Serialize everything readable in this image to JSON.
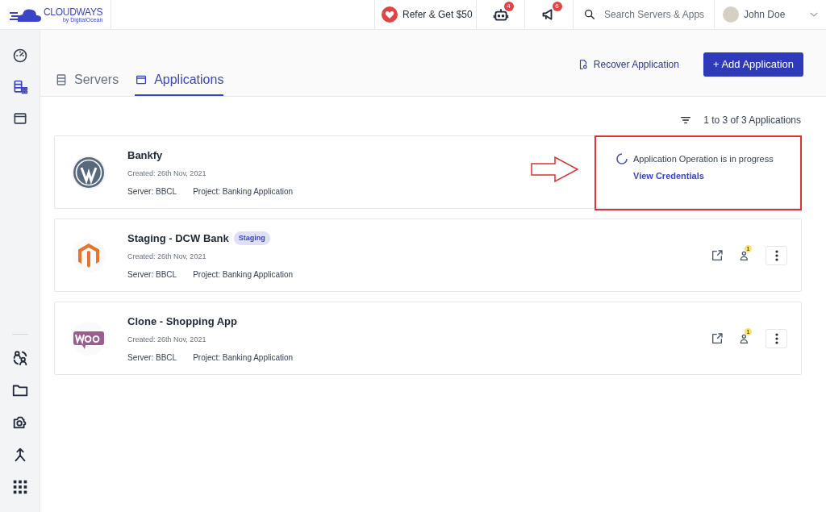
{
  "brand": {
    "name": "CLOUDWAYS",
    "byline": "by DigitalOcean"
  },
  "top_bar": {
    "refer": "Refer & Get $50",
    "bot_badge": "4",
    "announce_badge": "6",
    "search": {
      "placeholder": "Search Servers & Apps"
    },
    "user": "John Doe"
  },
  "sidebar": {
    "items": [
      {
        "selected": false
      },
      {
        "selected": true
      },
      {
        "selected": false
      }
    ],
    "bottom_items": [
      {
        "selected": false
      },
      {
        "selected": false
      },
      {
        "selected": false
      },
      {
        "selected": false
      },
      {
        "selected": false
      }
    ]
  },
  "tabs": [
    {
      "label": "Servers",
      "selected": false
    },
    {
      "label": "Applications",
      "selected": true
    }
  ],
  "actions": {
    "recover": "Recover Application",
    "add": "+ Add Application"
  },
  "count": "1 to 3 of 3 Applications",
  "apps": [
    {
      "name": "Bankfy",
      "logo": {
        "kind": "wordpress"
      },
      "created": "Created: 26th Nov, 2021",
      "server": "Server: BBCL",
      "project": "Project: Banking Application",
      "kind": "progress",
      "status": "Application Operation is in progress",
      "link": "View Credentials",
      "highlighted": true
    },
    {
      "name": "Staging - DCW Bank",
      "tag": "Staging",
      "logo": {
        "kind": "magento"
      },
      "created": "Created: 26th Nov, 2021",
      "server": "Server: BBCL",
      "project": "Project: Banking Application",
      "kind": "actions",
      "badge": "1"
    },
    {
      "name": "Clone - Shopping App",
      "logo": {
        "kind": "woo"
      },
      "created": "Created: 26th Nov, 2021",
      "server": "Server: BBCL",
      "project": "Project: Banking Application",
      "kind": "actions",
      "badge": "1"
    }
  ]
}
